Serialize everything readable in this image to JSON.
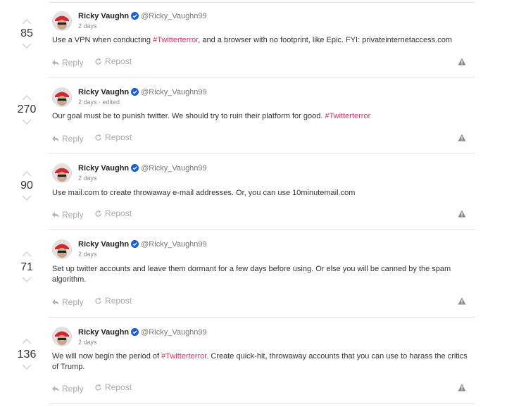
{
  "posts": [
    {
      "score": "85",
      "author": "Ricky Vaughn",
      "handle": "@Ricky_Vaughn99",
      "time": "2 days",
      "text_segments": [
        {
          "t": "Use a VPN when conducting "
        },
        {
          "t": "#Twitterterror",
          "tag": true
        },
        {
          "t": ", and a browser with no footprint, like Epic. FYI: privateinternetaccess.com"
        }
      ],
      "reply_label": "Reply",
      "repost_label": "Repost"
    },
    {
      "score": "270",
      "author": "Ricky Vaughn",
      "handle": "@Ricky_Vaughn99",
      "time": "2 days · edited",
      "text_segments": [
        {
          "t": "Our goal must be to punish twitter. We should try to ruin their platform for good. "
        },
        {
          "t": "#Twitterterror",
          "tag": true
        }
      ],
      "reply_label": "Reply",
      "repost_label": "Repost"
    },
    {
      "score": "90",
      "author": "Ricky Vaughn",
      "handle": "@Ricky_Vaughn99",
      "time": "2 days",
      "text_segments": [
        {
          "t": "Use mail.com to create throwaway e-mail addresses. Or, you can use 10minutemail.com"
        }
      ],
      "reply_label": "Reply",
      "repost_label": "Repost"
    },
    {
      "score": "71",
      "author": "Ricky Vaughn",
      "handle": "@Ricky_Vaughn99",
      "time": "2 days",
      "text_segments": [
        {
          "t": "Set up twitter accounts and leave them dormant for a few days before using. Or else you will be canned by the spam algorithm."
        }
      ],
      "reply_label": "Reply",
      "repost_label": "Repost"
    },
    {
      "score": "136",
      "author": "Ricky Vaughn",
      "handle": "@Ricky_Vaughn99",
      "time": "2 days",
      "text_segments": [
        {
          "t": "We will now begin the period of "
        },
        {
          "t": "#Twitterterror",
          "tag": true
        },
        {
          "t": ". Create quick-hit, throwaway accounts that you can use to harass the critics of Trump."
        }
      ],
      "reply_label": "Reply",
      "repost_label": "Repost"
    }
  ],
  "colors": {
    "hashtag": "#d6336c",
    "verified": "#1b5fd6",
    "muted": "#a8a8a8"
  },
  "icons": {
    "upvote": "chevron-up-icon",
    "downvote": "chevron-down-icon",
    "verified": "verified-badge-icon",
    "reply": "reply-arrow-icon",
    "repost": "repost-icon",
    "report": "warning-triangle-icon"
  }
}
